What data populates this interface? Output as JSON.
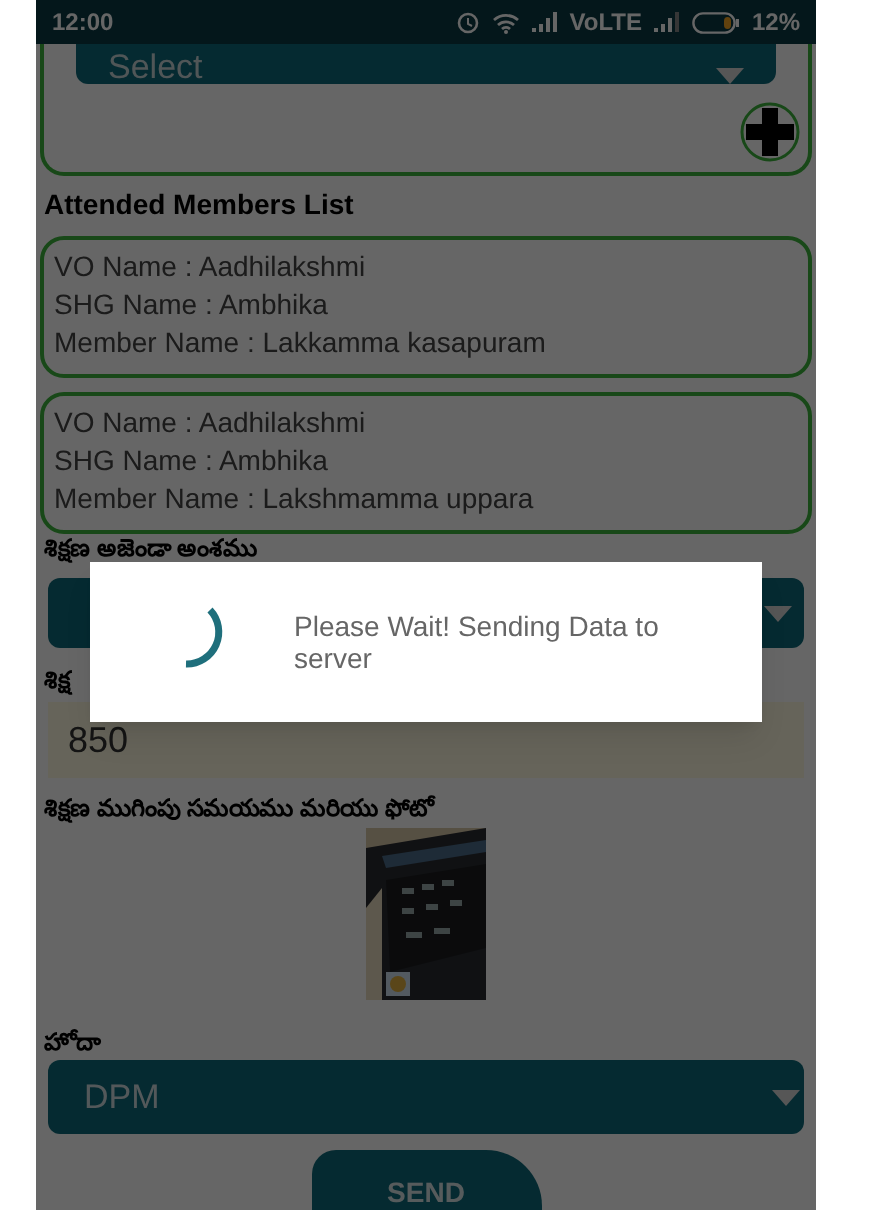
{
  "status_bar": {
    "time": "12:00",
    "network": "VoLTE",
    "battery": "12%"
  },
  "top_select": {
    "value": "Select"
  },
  "attended_title": "Attended Members List",
  "members": [
    {
      "vo": "VO Name : Aadhilakshmi",
      "shg": "SHG Name : Ambhika",
      "member": "Member Name : Lakkamma kasapuram"
    },
    {
      "vo": "VO Name : Aadhilakshmi",
      "shg": "SHG Name : Ambhika",
      "member": "Member Name : Lakshmamma uppara"
    }
  ],
  "agenda": {
    "label": "శిక్షణ అజెండా అంశము"
  },
  "count_field": {
    "label": "శిక్ష",
    "value": "850"
  },
  "photo": {
    "label": "శిక్షణ ముగింపు సమయము మరియు ఫోటో",
    "kind": "picture"
  },
  "designation": {
    "label": "హోదా",
    "value": "DPM"
  },
  "send_button": "SEND",
  "dialog": {
    "message": "Please Wait! Sending Data to server"
  }
}
